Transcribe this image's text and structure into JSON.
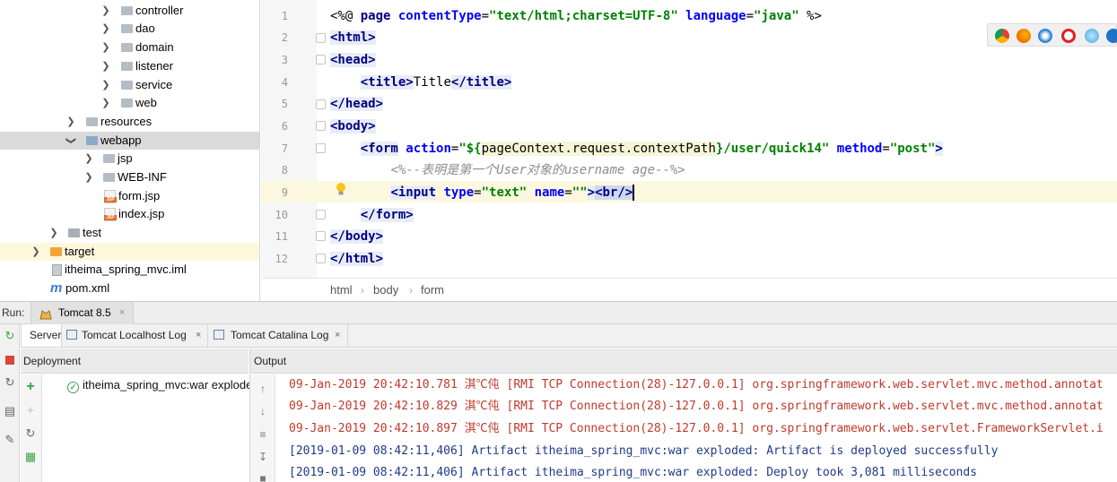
{
  "project_tree": {
    "items": [
      {
        "label": "controller"
      },
      {
        "label": "dao"
      },
      {
        "label": "domain"
      },
      {
        "label": "listener"
      },
      {
        "label": "service"
      },
      {
        "label": "web"
      },
      {
        "label": "resources"
      },
      {
        "label": "webapp"
      },
      {
        "label": "jsp"
      },
      {
        "label": "WEB-INF"
      },
      {
        "label": "form.jsp"
      },
      {
        "label": "index.jsp"
      },
      {
        "label": "test"
      },
      {
        "label": "target"
      },
      {
        "label": "itheima_spring_mvc.iml"
      },
      {
        "label": "pom.xml"
      }
    ]
  },
  "editor": {
    "line_numbers": [
      "1",
      "2",
      "3",
      "4",
      "5",
      "6",
      "7",
      "8",
      "9",
      "10",
      "11",
      "12"
    ],
    "l1": {
      "a": "<%@ ",
      "b": "page",
      "c": " contentType",
      "d": "=",
      "e": "\"text/html;charset=UTF-8\"",
      "f": " language",
      "g": "=",
      "h": "\"java\"",
      "i": " %>"
    },
    "l2": {
      "a": "<html>"
    },
    "l3": {
      "a": "<head>"
    },
    "l4": {
      "a": "    ",
      "b": "<title>",
      "c": "Title",
      "d": "</title>"
    },
    "l5": {
      "a": "</head>"
    },
    "l6": {
      "a": "<body>"
    },
    "l7": {
      "a": "    ",
      "b": "<form",
      "c": " action",
      "d": "=",
      "e": "\"${",
      "f": "pageContext.request.contextPath",
      "g": "}/user/quick14\"",
      "h": " method",
      "i": "=",
      "j": "\"post\"",
      "k": ">"
    },
    "l8": {
      "a": "        ",
      "b": "<%--表明是第一个User对象的username age--%>"
    },
    "l9": {
      "a": "        ",
      "b": "<input",
      "c": " type",
      "d": "=",
      "e": "\"text\"",
      "f": " name",
      "g": "=",
      "h": "\"\"",
      "i": ">",
      "j": "<br/>"
    },
    "l10": {
      "a": "    ",
      "b": "</form>"
    },
    "l11": {
      "a": "</body>"
    },
    "l12": {
      "a": "</html>"
    }
  },
  "breadcrumb": [
    "html",
    "body",
    "form"
  ],
  "run": {
    "label": "Run:",
    "config_tab": "Tomcat 8.5",
    "tabs": [
      "Server",
      "Tomcat Localhost Log",
      "Tomcat Catalina Log"
    ]
  },
  "deployment": {
    "header": "Deployment",
    "item": "itheima_spring_mvc:war exploded"
  },
  "output": {
    "header": "Output",
    "lines": [
      "09-Jan-2019 20:42:10.781 淇℃伅 [RMI TCP Connection(28)-127.0.0.1] org.springframework.web.servlet.mvc.method.annotat",
      "09-Jan-2019 20:42:10.829 淇℃伅 [RMI TCP Connection(28)-127.0.0.1] org.springframework.web.servlet.mvc.method.annotat",
      "09-Jan-2019 20:42:10.897 淇℃伅 [RMI TCP Connection(28)-127.0.0.1] org.springframework.web.servlet.FrameworkServlet.i",
      "[2019-01-09 08:42:11,406] Artifact itheima_spring_mvc:war exploded: Artifact is deployed successfully",
      "[2019-01-09 08:42:11,406] Artifact itheima_spring_mvc:war exploded: Deploy took 3,081 milliseconds"
    ]
  },
  "colors": {
    "log_red": "#c0392b",
    "log_blue": "#1f3b8a",
    "selection": "#dadada",
    "caret_line": "#fcf8e0"
  }
}
